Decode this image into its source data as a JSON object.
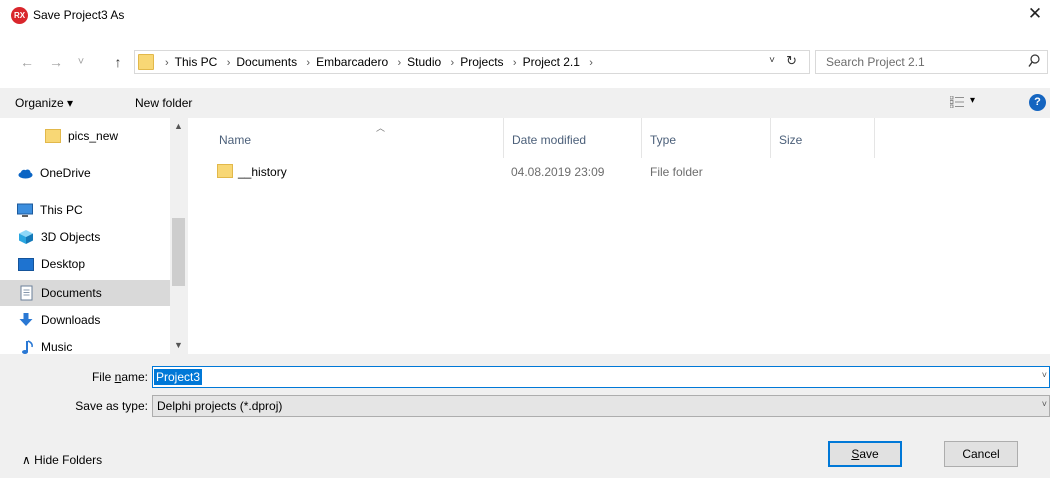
{
  "window": {
    "title": "Save Project3 As",
    "app_icon_text": "RX",
    "close_glyph": "✕"
  },
  "nav": {
    "back": "←",
    "forward": "→",
    "recent": "˅",
    "up": "↑"
  },
  "address": {
    "crumbs": [
      "This PC",
      "Documents",
      "Embarcadero",
      "Studio",
      "Projects",
      "Project 2.1"
    ],
    "dropdown_glyph": "˅",
    "refresh_glyph": "↻"
  },
  "search": {
    "placeholder": "Search Project 2.1"
  },
  "commands": {
    "organize": "Organize ▾",
    "new_folder": "New folder",
    "view_dropdown": "▾",
    "help": "?"
  },
  "sidebar": {
    "items": [
      {
        "label": "pics_new",
        "icon": "folder-icon"
      },
      {
        "label": "OneDrive",
        "icon": "cloud-icon"
      },
      {
        "label": "This PC",
        "icon": "computer-icon"
      },
      {
        "label": "3D Objects",
        "icon": "cube-icon"
      },
      {
        "label": "Desktop",
        "icon": "desktop-icon"
      },
      {
        "label": "Documents",
        "icon": "documents-icon",
        "selected": true
      },
      {
        "label": "Downloads",
        "icon": "download-icon"
      },
      {
        "label": "Music",
        "icon": "music-icon"
      }
    ],
    "scroll_up": "▲",
    "scroll_down": "▼"
  },
  "columns": {
    "name": "Name",
    "date": "Date modified",
    "type": "Type",
    "size": "Size",
    "sort_glyph": "︿"
  },
  "files": [
    {
      "name": "__history",
      "date": "04.08.2019 23:09",
      "type": "File folder",
      "size": ""
    }
  ],
  "form": {
    "file_name_label_pre": "File ",
    "file_name_label_key": "n",
    "file_name_label_post": "ame:",
    "file_name_value": "Project3",
    "save_type_label": "Save as type:",
    "save_type_value": "Delphi projects (*.dproj)",
    "dropdown_glyph": "˅"
  },
  "footer": {
    "hide_folders": "∧  Hide Folders",
    "save_key": "S",
    "save_rest": "ave",
    "cancel": "Cancel"
  }
}
